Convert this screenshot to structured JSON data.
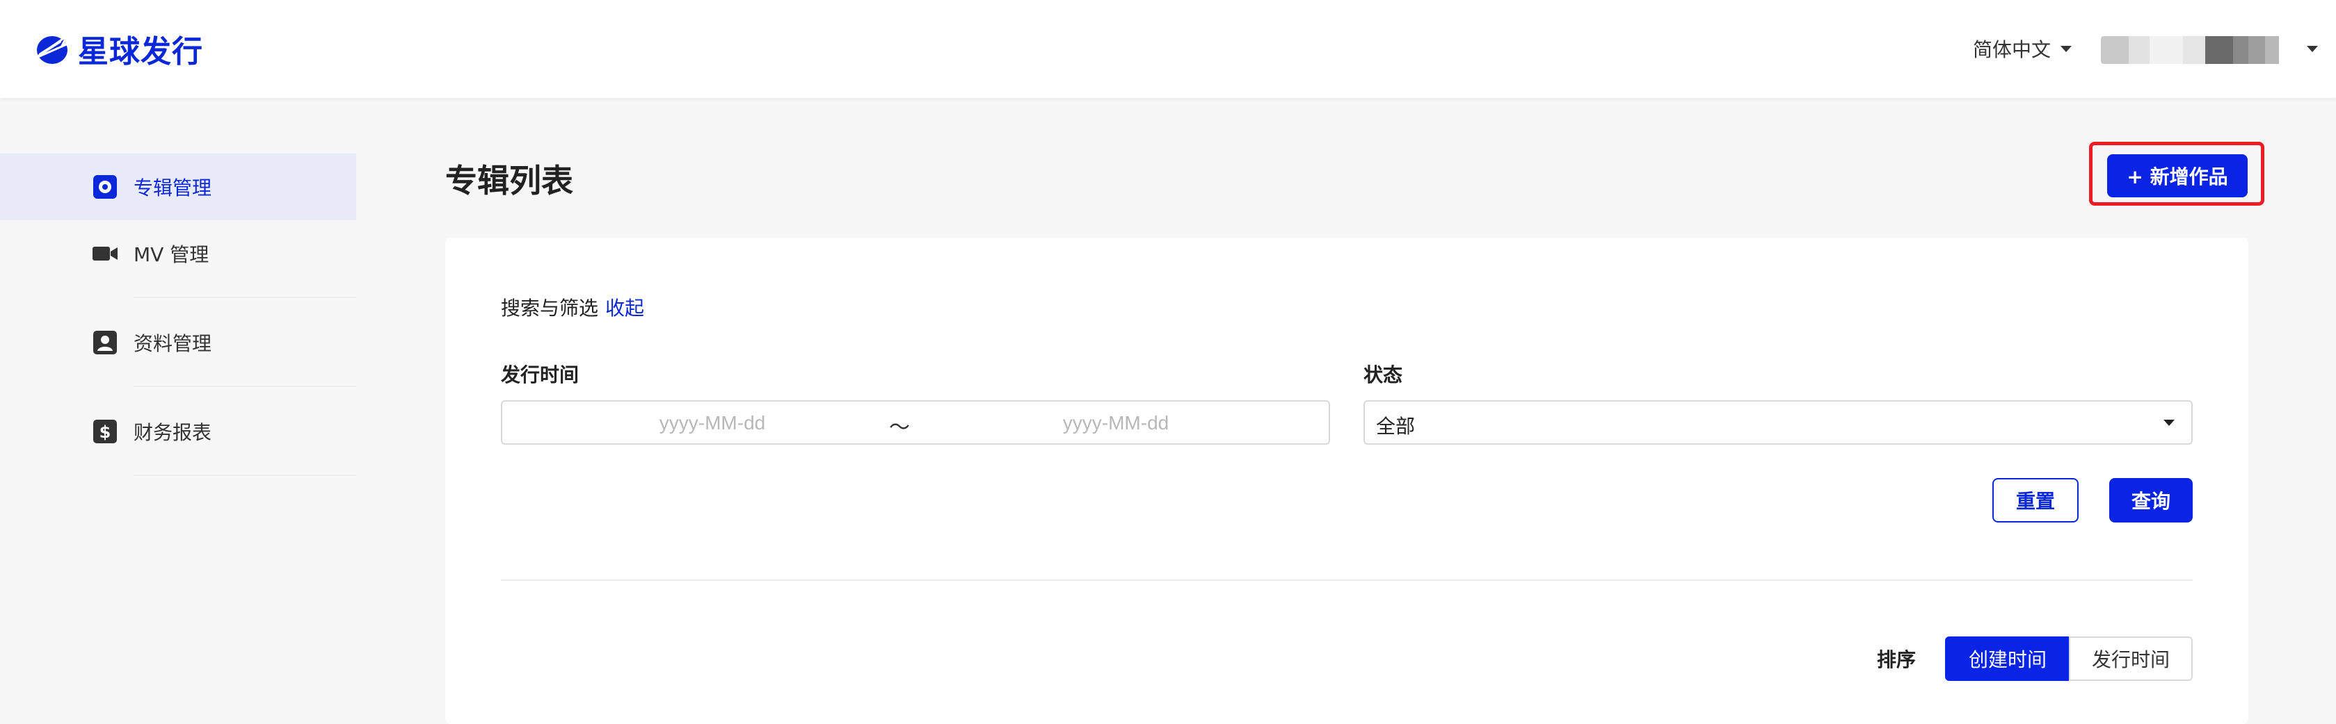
{
  "header": {
    "logo_text": "星球发行",
    "language": "简体中文",
    "username_blur_colors": [
      "#c9c9c9",
      "#e2e2e2",
      "#f1f1f1",
      "#e6e6e6",
      "#6a6a6a",
      "#8a8a8a",
      "#9e9e9e",
      "#b8b8b8"
    ]
  },
  "sidebar": {
    "items": [
      {
        "label": "专辑管理",
        "icon": "album-icon",
        "active": true
      },
      {
        "label": "MV 管理",
        "icon": "video-camera-icon",
        "active": false
      },
      {
        "label": "资料管理",
        "icon": "profile-card-icon",
        "active": false
      },
      {
        "label": "财务报表",
        "icon": "dollar-icon",
        "active": false
      }
    ]
  },
  "main": {
    "title": "专辑列表",
    "add_button": "+ 新增作品",
    "filter": {
      "heading": "搜索与筛选",
      "collapse": "收起",
      "date_label": "发行时间",
      "date_start_placeholder": "yyyy-MM-dd",
      "date_separator": "～",
      "date_end_placeholder": "yyyy-MM-dd",
      "status_label": "状态",
      "status_value": "全部",
      "reset": "重置",
      "query": "查询"
    },
    "sort": {
      "label": "排序",
      "options": [
        "创建时间",
        "发行时间"
      ],
      "active_index": 0
    }
  },
  "colors": {
    "primary": "#0a24e6",
    "highlight": "#ee1c24"
  }
}
